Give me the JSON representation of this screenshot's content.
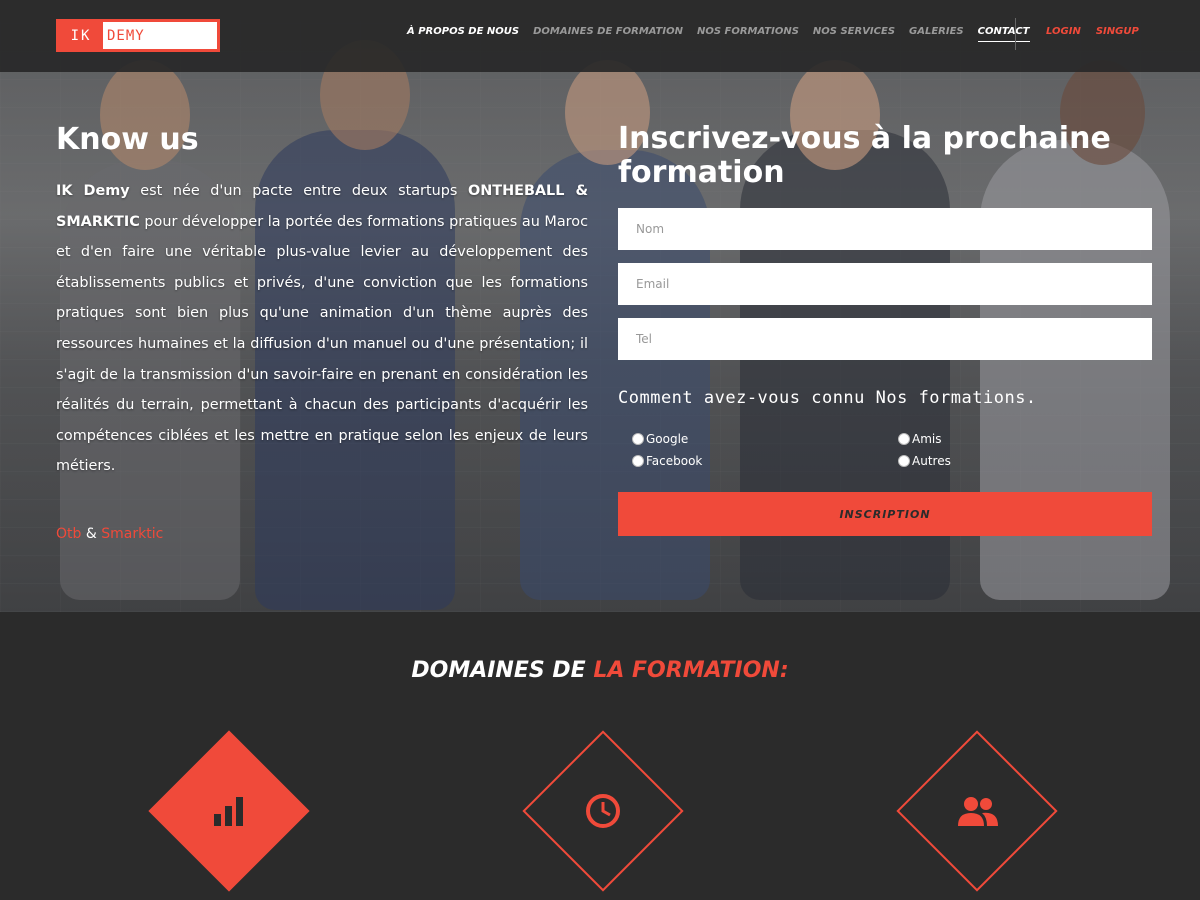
{
  "brand": {
    "ik": "IK",
    "demy": "DEMY"
  },
  "nav": {
    "items": [
      {
        "label": "À PROPOS DE NOUS"
      },
      {
        "label": "DOMAINES DE FORMATION"
      },
      {
        "label": "NOS FORMATIONS"
      },
      {
        "label": "NOS SERVICES"
      },
      {
        "label": "GALERIES"
      },
      {
        "label": "CONTACT"
      }
    ],
    "login": "LOGIN",
    "signup": "SINGUP"
  },
  "know": {
    "title": "Know us",
    "brand_name": "IK Demy",
    "text_1": " est née d'un pacte entre deux startups ",
    "partners": "ONTHEBALL & SMARKTIC",
    "text_2": " pour développer la portée des formations pratiques au Maroc et d'en faire une véritable plus-value levier au développement des établissements publics et privés, d'une conviction que les formations pratiques sont bien plus qu'une animation d'un thème auprès des ressources humaines et la diffusion d'un manuel ou d'une présentation; il s'agit de la transmission d'un savoir-faire en prenant en considération les réalités du terrain, permettant à chacun des participants d'acquérir les compétences ciblées et les mettre en pratique selon les enjeux de leurs métiers.",
    "sign_1": "Otb",
    "sign_amp": " & ",
    "sign_2": "Smarktic"
  },
  "form": {
    "title": "Inscrivez-vous à la prochaine formation",
    "nom_placeholder": "Nom",
    "email_placeholder": "Email",
    "tel_placeholder": "Tel",
    "question": "Comment avez-vous connu Nos formations.",
    "options": [
      "Google",
      "Facebook",
      "Amis",
      "Autres"
    ],
    "submit": "INSCRIPTION"
  },
  "domaines": {
    "title_white": "DOMAINES DE ",
    "title_red": "LA FORMATION:",
    "icons": [
      "bar-chart-icon",
      "clock-icon",
      "users-icon"
    ]
  },
  "colors": {
    "accent": "#f04a3a",
    "dark": "#2b2b2b"
  }
}
